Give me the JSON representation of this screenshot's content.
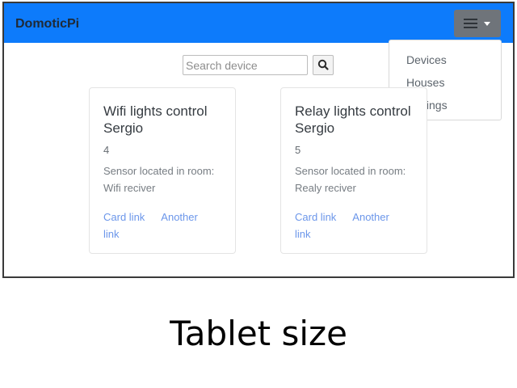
{
  "navbar": {
    "brand": "DomoticPi",
    "toggler_icon": "hamburger-icon",
    "dropdown_caret_icon": "caret-down-icon",
    "menu": [
      "Devices",
      "Houses",
      "Settings"
    ]
  },
  "search": {
    "placeholder": "Search device",
    "button_icon": "search-icon"
  },
  "cards": [
    {
      "title": "Wifi lights control Sergio",
      "number": "4",
      "text": "Sensor located in room: Wifi reciver",
      "link1": "Card link",
      "link2": "Another link"
    },
    {
      "title": "Relay lights control Sergio",
      "number": "5",
      "text": "Sensor located in room: Realy reciver",
      "link1": "Card link",
      "link2": "Another link"
    }
  ],
  "caption": "Tablet size",
  "colors": {
    "navbar": "#0d7bfb",
    "link": "#6b96ea",
    "toggler": "#6f747a"
  }
}
